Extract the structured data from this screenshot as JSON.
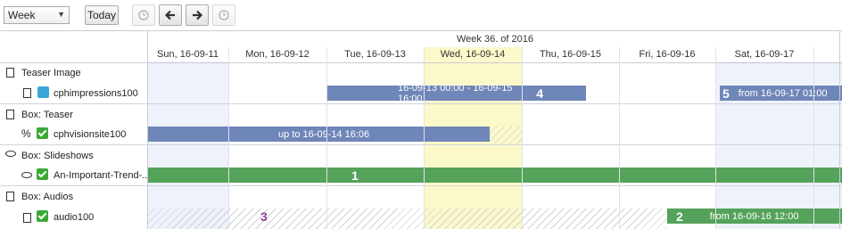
{
  "toolbar": {
    "view_select": "Week",
    "today_label": "Today"
  },
  "header": {
    "week": "Week 36. of 2016",
    "days": [
      "Sun, 16-09-11",
      "Mon, 16-09-12",
      "Tue, 16-09-13",
      "Wed, 16-09-14",
      "Thu, 16-09-15",
      "Fri, 16-09-16",
      "Sat, 16-09-17"
    ]
  },
  "rows": {
    "g1": "Teaser Image",
    "i1": "cphimpressions100",
    "g2": "Box: Teaser",
    "i2": "cphvisionsite100",
    "g3": "Box: Slideshows",
    "i3": "An-Important-Trend-...",
    "g4": "Box: Audios",
    "i4": "audio100"
  },
  "bars": {
    "b4_text": "16-09-13 00:00 - 16-09-15 16:00",
    "b4_num": "4",
    "b5_num": "5",
    "b5_text": "from 16-09-17 01:00",
    "b_teaser_text": "up to 16-09-14 16:06",
    "b1_num": "1",
    "b3_num": "3",
    "b2_num": "2",
    "b2_text": "from 16-09-16 12:00"
  },
  "colors": {
    "blue_bar": "#6f86b8",
    "green_bar": "#55a25a",
    "today_col": "#fbf9c9",
    "weekend_col": "#eef2fb"
  }
}
